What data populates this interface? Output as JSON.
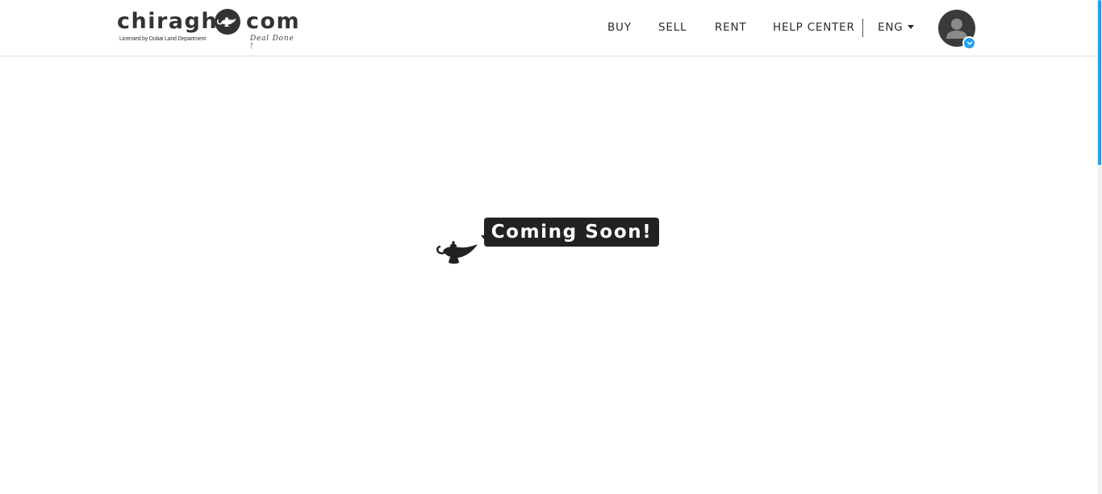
{
  "brand": {
    "name_left": "chiragh",
    "name_right": "com",
    "license_text": "Licensed by Dubai Land Department",
    "tagline": "Deal Done !",
    "logo_icon": "genie-lamp-icon"
  },
  "nav": {
    "items": [
      {
        "label": "BUY"
      },
      {
        "label": "SELL"
      },
      {
        "label": "RENT"
      },
      {
        "label": "HELP CENTER"
      }
    ],
    "language": "ENG"
  },
  "user": {
    "avatar_icon": "user-icon",
    "badge_icon": "chevron-down-icon"
  },
  "main": {
    "message": "Coming Soon!",
    "icon": "genie-lamp-icon"
  },
  "colors": {
    "accent": "#1da1f2",
    "dark": "#222222",
    "text": "#2b2b2b"
  }
}
